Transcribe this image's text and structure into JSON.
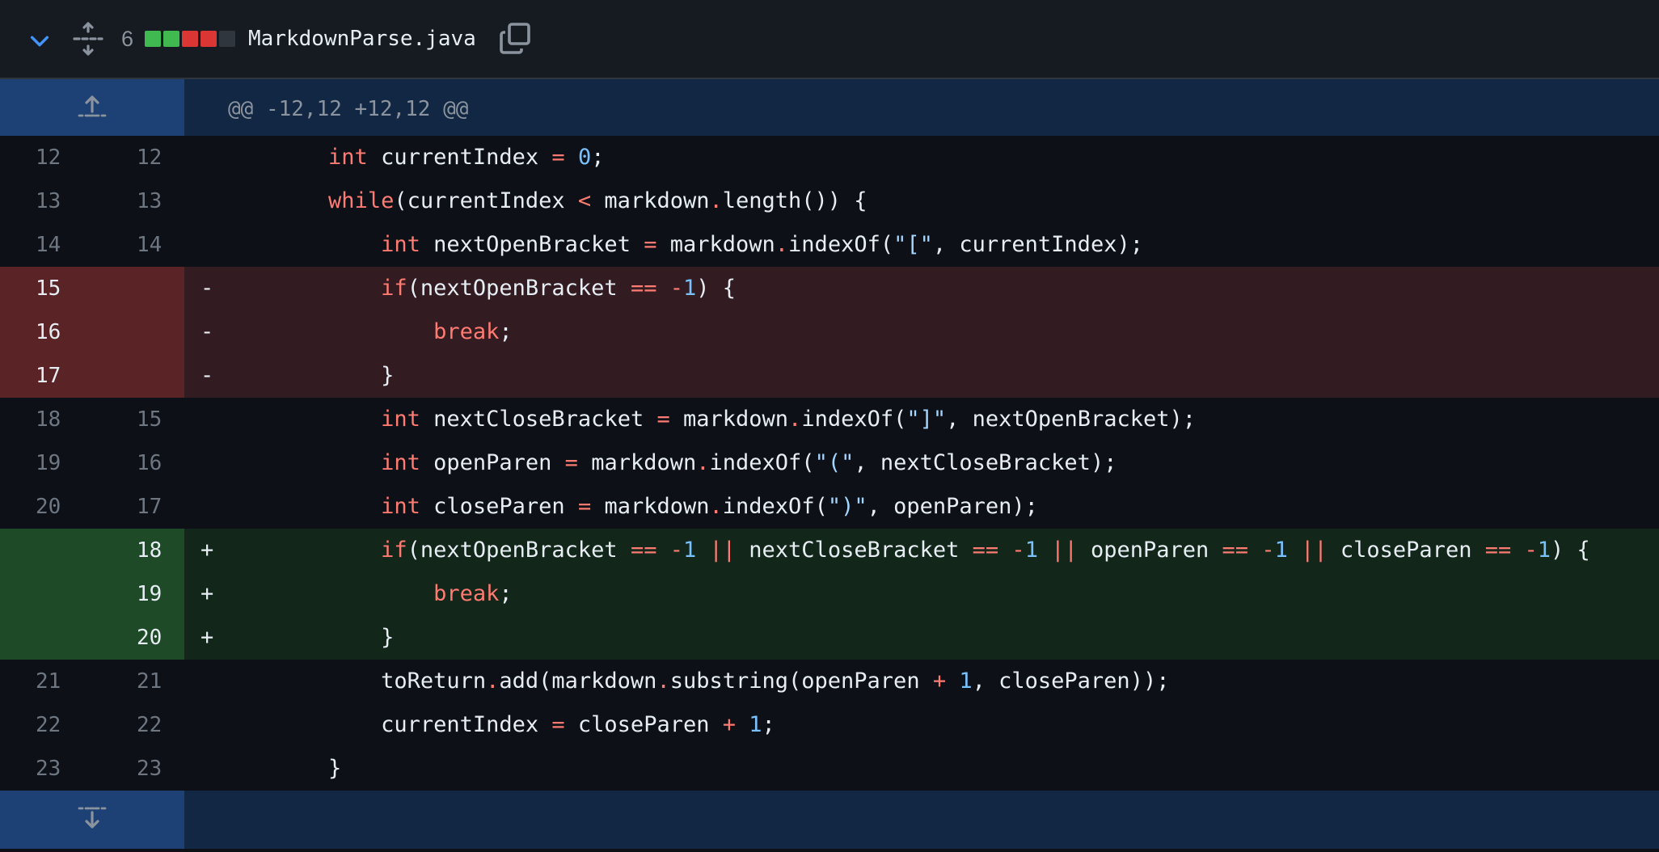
{
  "file_header": {
    "changes_count": "6",
    "filename": "MarkdownParse.java",
    "diffstat": [
      "#3fb950",
      "#3fb950",
      "#da3633",
      "#da3633",
      "#30363d"
    ]
  },
  "hunk": {
    "header": "@@ -12,12 +12,12 @@"
  },
  "lines": [
    {
      "type": "ctx",
      "old": "12",
      "new": "12",
      "marker": "",
      "tokens": [
        [
          "",
          "        "
        ],
        [
          "kw",
          "int"
        ],
        [
          "",
          " currentIndex "
        ],
        [
          "kw",
          "="
        ],
        [
          "",
          " "
        ],
        [
          "num-lit",
          "0"
        ],
        [
          "",
          ";"
        ]
      ]
    },
    {
      "type": "ctx",
      "old": "13",
      "new": "13",
      "marker": "",
      "tokens": [
        [
          "",
          "        "
        ],
        [
          "kw",
          "while"
        ],
        [
          "",
          "(currentIndex "
        ],
        [
          "kw",
          "<"
        ],
        [
          "",
          " markdown"
        ],
        [
          "kw",
          "."
        ],
        [
          "",
          "length()) {"
        ]
      ]
    },
    {
      "type": "ctx",
      "old": "14",
      "new": "14",
      "marker": "",
      "tokens": [
        [
          "",
          "            "
        ],
        [
          "kw",
          "int"
        ],
        [
          "",
          " nextOpenBracket "
        ],
        [
          "kw",
          "="
        ],
        [
          "",
          " markdown"
        ],
        [
          "kw",
          "."
        ],
        [
          "",
          "indexOf("
        ],
        [
          "str",
          "\"[\""
        ],
        [
          "",
          ", currentIndex);"
        ]
      ]
    },
    {
      "type": "del",
      "old": "15",
      "new": "",
      "marker": "-",
      "tokens": [
        [
          "",
          "            "
        ],
        [
          "kw",
          "if"
        ],
        [
          "",
          "(nextOpenBracket "
        ],
        [
          "kw",
          "=="
        ],
        [
          "",
          " "
        ],
        [
          "kw",
          "-"
        ],
        [
          "num-lit",
          "1"
        ],
        [
          "",
          ") {"
        ]
      ]
    },
    {
      "type": "del",
      "old": "16",
      "new": "",
      "marker": "-",
      "tokens": [
        [
          "",
          "                "
        ],
        [
          "kw",
          "break"
        ],
        [
          "",
          ";"
        ]
      ]
    },
    {
      "type": "del",
      "old": "17",
      "new": "",
      "marker": "-",
      "tokens": [
        [
          "",
          "            }"
        ]
      ]
    },
    {
      "type": "ctx",
      "old": "18",
      "new": "15",
      "marker": "",
      "tokens": [
        [
          "",
          "            "
        ],
        [
          "kw",
          "int"
        ],
        [
          "",
          " nextCloseBracket "
        ],
        [
          "kw",
          "="
        ],
        [
          "",
          " markdown"
        ],
        [
          "kw",
          "."
        ],
        [
          "",
          "indexOf("
        ],
        [
          "str",
          "\"]\""
        ],
        [
          "",
          ", nextOpenBracket);"
        ]
      ]
    },
    {
      "type": "ctx",
      "old": "19",
      "new": "16",
      "marker": "",
      "tokens": [
        [
          "",
          "            "
        ],
        [
          "kw",
          "int"
        ],
        [
          "",
          " openParen "
        ],
        [
          "kw",
          "="
        ],
        [
          "",
          " markdown"
        ],
        [
          "kw",
          "."
        ],
        [
          "",
          "indexOf("
        ],
        [
          "str",
          "\"(\""
        ],
        [
          "",
          ", nextCloseBracket);"
        ]
      ]
    },
    {
      "type": "ctx",
      "old": "20",
      "new": "17",
      "marker": "",
      "tokens": [
        [
          "",
          "            "
        ],
        [
          "kw",
          "int"
        ],
        [
          "",
          " closeParen "
        ],
        [
          "kw",
          "="
        ],
        [
          "",
          " markdown"
        ],
        [
          "kw",
          "."
        ],
        [
          "",
          "indexOf("
        ],
        [
          "str",
          "\")\""
        ],
        [
          "",
          ", openParen);"
        ]
      ]
    },
    {
      "type": "add",
      "old": "",
      "new": "18",
      "marker": "+",
      "tokens": [
        [
          "",
          "            "
        ],
        [
          "kw",
          "if"
        ],
        [
          "",
          "(nextOpenBracket "
        ],
        [
          "kw",
          "=="
        ],
        [
          "",
          " "
        ],
        [
          "kw",
          "-"
        ],
        [
          "num-lit",
          "1"
        ],
        [
          "",
          " "
        ],
        [
          "kw",
          "||"
        ],
        [
          "",
          " nextCloseBracket "
        ],
        [
          "kw",
          "=="
        ],
        [
          "",
          " "
        ],
        [
          "kw",
          "-"
        ],
        [
          "num-lit",
          "1"
        ],
        [
          "",
          " "
        ],
        [
          "kw",
          "||"
        ],
        [
          "",
          " openParen "
        ],
        [
          "kw",
          "=="
        ],
        [
          "",
          " "
        ],
        [
          "kw",
          "-"
        ],
        [
          "num-lit",
          "1"
        ],
        [
          "",
          " "
        ],
        [
          "kw",
          "||"
        ],
        [
          "",
          " closeParen "
        ],
        [
          "kw",
          "=="
        ],
        [
          "",
          " "
        ],
        [
          "kw",
          "-"
        ],
        [
          "num-lit",
          "1"
        ],
        [
          "",
          ") {"
        ]
      ]
    },
    {
      "type": "add",
      "old": "",
      "new": "19",
      "marker": "+",
      "tokens": [
        [
          "",
          "                "
        ],
        [
          "kw",
          "break"
        ],
        [
          "",
          ";"
        ]
      ]
    },
    {
      "type": "add",
      "old": "",
      "new": "20",
      "marker": "+",
      "tokens": [
        [
          "",
          "            }"
        ]
      ]
    },
    {
      "type": "ctx",
      "old": "21",
      "new": "21",
      "marker": "",
      "tokens": [
        [
          "",
          "            toReturn"
        ],
        [
          "kw",
          "."
        ],
        [
          "",
          "add(markdown"
        ],
        [
          "kw",
          "."
        ],
        [
          "",
          "substring(openParen "
        ],
        [
          "kw",
          "+"
        ],
        [
          "",
          " "
        ],
        [
          "num-lit",
          "1"
        ],
        [
          "",
          ", closeParen));"
        ]
      ]
    },
    {
      "type": "ctx",
      "old": "22",
      "new": "22",
      "marker": "",
      "tokens": [
        [
          "",
          "            currentIndex "
        ],
        [
          "kw",
          "="
        ],
        [
          "",
          " closeParen "
        ],
        [
          "kw",
          "+"
        ],
        [
          "",
          " "
        ],
        [
          "num-lit",
          "1"
        ],
        [
          "",
          ";"
        ]
      ]
    },
    {
      "type": "ctx",
      "old": "23",
      "new": "23",
      "marker": "",
      "tokens": [
        [
          "",
          "        }"
        ]
      ]
    }
  ],
  "icons": {
    "collapse": "chevron-down-icon",
    "expand_all": "unfold-icon",
    "copy": "copy-icon",
    "expand_up": "expand-up-icon",
    "expand_down": "expand-down-icon"
  }
}
